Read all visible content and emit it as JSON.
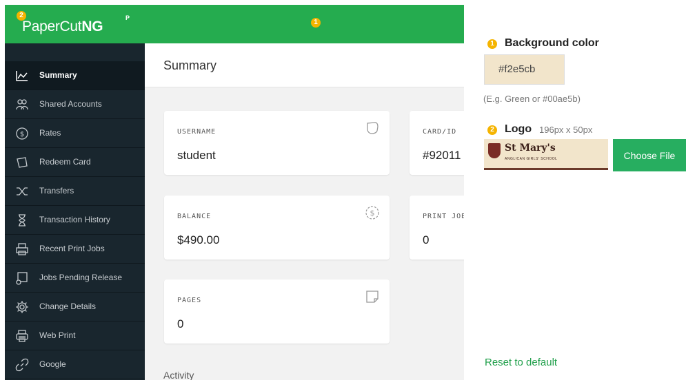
{
  "preview": {
    "header_badge": "1",
    "logo": {
      "badge": "2",
      "brand": "PaperCut",
      "suffix": "NG",
      "superscript": "P"
    },
    "sidebar": {
      "items": [
        {
          "label": "Summary",
          "icon": "chart-line-icon",
          "active": true
        },
        {
          "label": "Shared Accounts",
          "icon": "users-icon",
          "active": false
        },
        {
          "label": "Rates",
          "icon": "dollar-circle-icon",
          "active": false
        },
        {
          "label": "Redeem Card",
          "icon": "card-tag-icon",
          "active": false
        },
        {
          "label": "Transfers",
          "icon": "shuffle-icon",
          "active": false
        },
        {
          "label": "Transaction History",
          "icon": "hourglass-icon",
          "active": false
        },
        {
          "label": "Recent Print Jobs",
          "icon": "printer-icon",
          "active": false
        },
        {
          "label": "Jobs Pending Release",
          "icon": "print-queue-icon",
          "active": false
        },
        {
          "label": "Change Details",
          "icon": "gear-icon",
          "active": false
        },
        {
          "label": "Web Print",
          "icon": "web-print-icon",
          "active": false
        },
        {
          "label": "Google",
          "icon": "link-icon",
          "active": false
        }
      ]
    },
    "main": {
      "title": "Summary",
      "cards": {
        "username": {
          "label": "USERNAME",
          "value": "student",
          "icon": "tag-icon"
        },
        "card_id": {
          "label": "CARD/ID",
          "value": "#92011"
        },
        "balance": {
          "label": "BALANCE",
          "value": "$490.00",
          "icon": "dollar-circle-icon"
        },
        "print_jobs": {
          "label": "PRINT JOB",
          "value": "0"
        },
        "pages": {
          "label": "PAGES",
          "value": "0",
          "icon": "page-icon"
        }
      },
      "activity_label": "Activity"
    }
  },
  "settings": {
    "background": {
      "badge": "1",
      "label": "Background color",
      "value": "#f2e5cb",
      "hint": "(E.g. Green or #00ae5b)"
    },
    "logo": {
      "badge": "2",
      "label": "Logo",
      "size_hint": "196px x 50px",
      "preview_text": "St Mary's",
      "preview_subtext": "ANGLICAN GIRLS' SCHOOL",
      "choose_button": "Choose File"
    },
    "reset_link": "Reset to default"
  },
  "colors": {
    "header_green": "#25ac4f",
    "sidebar_dark": "#19262e",
    "badge_orange": "#f5b400",
    "button_green": "#27ae60",
    "link_green": "#1f9f4a"
  }
}
